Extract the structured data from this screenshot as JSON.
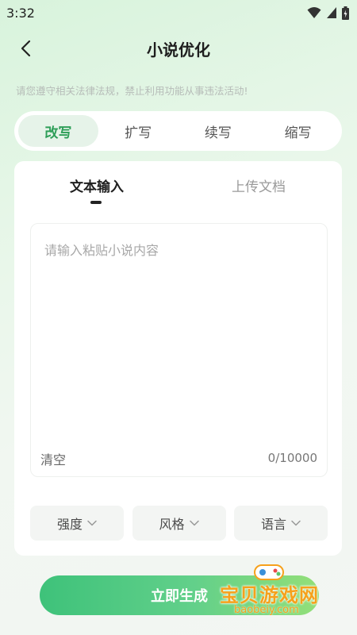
{
  "status_bar": {
    "time": "3:32"
  },
  "header": {
    "title": "小说优化"
  },
  "notice": "请您遵守相关法律法规，禁止利用功能从事违法活动!",
  "mode_tabs": [
    {
      "label": "改写",
      "active": true
    },
    {
      "label": "扩写",
      "active": false
    },
    {
      "label": "续写",
      "active": false
    },
    {
      "label": "缩写",
      "active": false
    }
  ],
  "input_tabs": [
    {
      "label": "文本输入",
      "active": true
    },
    {
      "label": "上传文档",
      "active": false
    }
  ],
  "textbox": {
    "placeholder": "请输入粘贴小说内容",
    "clear_label": "清空",
    "char_count": "0/10000"
  },
  "options": [
    {
      "label": "强度"
    },
    {
      "label": "风格"
    },
    {
      "label": "语言"
    }
  ],
  "generate_button": "立即生成",
  "watermark": {
    "text": "宝贝游戏网",
    "url": "baobeiy.com"
  },
  "colors": {
    "accent": "#2e9e58",
    "button_start": "#3ec27a",
    "button_end": "#93df78",
    "watermark": "#f6a11c"
  }
}
